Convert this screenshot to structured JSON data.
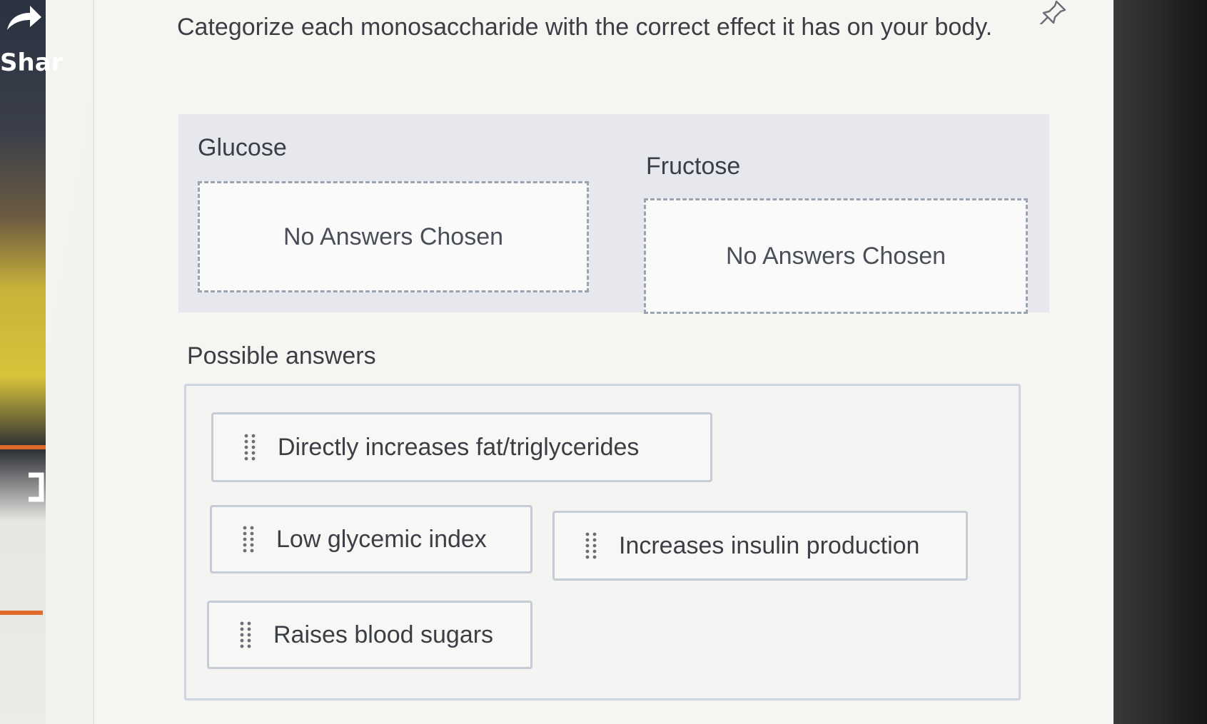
{
  "sidebar": {
    "share_label": "Shar",
    "share_icon": "share-arrow-icon",
    "bracket_icon": "bracket-icon"
  },
  "question": {
    "text": "Categorize each monosaccharide with the correct effect it has on your body.",
    "pin_icon": "pin-icon"
  },
  "categories": [
    {
      "title": "Glucose",
      "placeholder": "No Answers Chosen"
    },
    {
      "title": "Fructose",
      "placeholder": "No Answers Chosen"
    }
  ],
  "possible_answers": {
    "title": "Possible answers",
    "items": [
      {
        "label": "Directly increases fat/triglycerides",
        "icon": "drag-handle-icon"
      },
      {
        "label": "Low glycemic index",
        "icon": "drag-handle-icon"
      },
      {
        "label": "Increases insulin production",
        "icon": "drag-handle-icon"
      },
      {
        "label": "Raises blood sugars",
        "icon": "drag-handle-icon"
      }
    ]
  },
  "colors": {
    "text": "#3b3e45",
    "dashed_border": "#9aa3b2",
    "chip_border": "#c6ccd6",
    "band": "#e6e8ee",
    "accent_orange": "#e06a2a"
  }
}
